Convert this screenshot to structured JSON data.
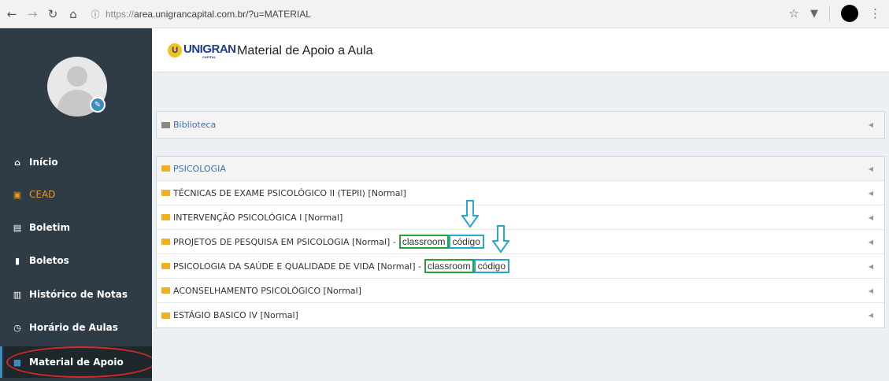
{
  "browser": {
    "url_protocol": "https://",
    "url_rest": "area.unigrancapital.com.br/?u=MATERIAL"
  },
  "sidebar": {
    "items": [
      {
        "label": "Início",
        "icon": "home-icon"
      },
      {
        "label": "CEAD",
        "icon": "play-icon"
      },
      {
        "label": "Boletim",
        "icon": "comment-icon"
      },
      {
        "label": "Boletos",
        "icon": "file-icon"
      },
      {
        "label": "Histórico de Notas",
        "icon": "chart-icon"
      },
      {
        "label": "Horário de Aulas",
        "icon": "clock-icon"
      },
      {
        "label": "Material de Apoio",
        "icon": "folder-icon"
      }
    ]
  },
  "header": {
    "logo": "UNIGRAN",
    "logo_sub": "CAPITAL",
    "title": "Material de Apoio a Aula"
  },
  "library": {
    "label": "Biblioteca"
  },
  "courses": {
    "heading": "PSICOLOGIA",
    "items": [
      {
        "label": "TÉCNICAS DE EXAME PSICOLÓGICO II (TEPII) [Normal]"
      },
      {
        "label": "INTERVENÇÃO PSICOLÓGICA I [Normal]"
      },
      {
        "label": "PROJETOS DE PESQUISA EM PSICOLOGIA [Normal] -",
        "tag1": "classroom",
        "tag2": "código"
      },
      {
        "label": "PSICOLOGIA DA SAÚDE E QUALIDADE DE VIDA [Normal] -",
        "tag1": "classroom",
        "tag2": "código"
      },
      {
        "label": "ACONSELHAMENTO PSICOLÓGICO [Normal]"
      },
      {
        "label": "ESTÁGIO BASICO IV [Normal]"
      }
    ]
  },
  "colors": {
    "sidebar_bg": "#2f3b45",
    "cead": "#e69c24",
    "highlight_green": "#23a43d",
    "highlight_blue": "#2aa6d4",
    "annotation_red": "#d42a2a"
  }
}
